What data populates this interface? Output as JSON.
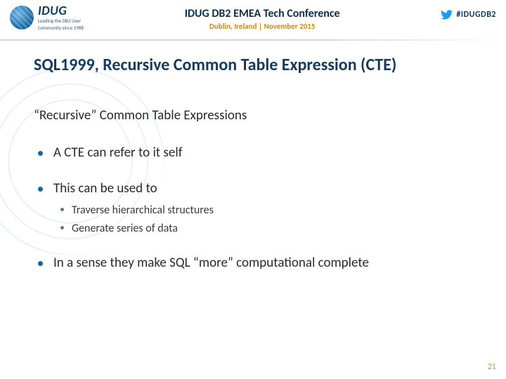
{
  "header": {
    "logo_main": "IDUG",
    "logo_tag_l1": "Leading the DB2 User",
    "logo_tag_l2": "Community since 1988",
    "conf_title": "IDUG DB2 EMEA Tech Conference",
    "conf_sub": "Dublin, Ireland  |  November 2015",
    "hashtag": "#IDUGDB2"
  },
  "title": "SQL1999, Recursive Common Table Expression (CTE)",
  "subheading": "“Recursive” Common Table Expressions",
  "bullets": [
    {
      "text": "A CTE can refer to it self"
    },
    {
      "text": "This can be used to",
      "sub": [
        "Traverse hierarchical structures",
        "Generate series of data"
      ]
    },
    {
      "text": "In a sense they make SQL “more” computational complete"
    }
  ],
  "page_number": "21"
}
